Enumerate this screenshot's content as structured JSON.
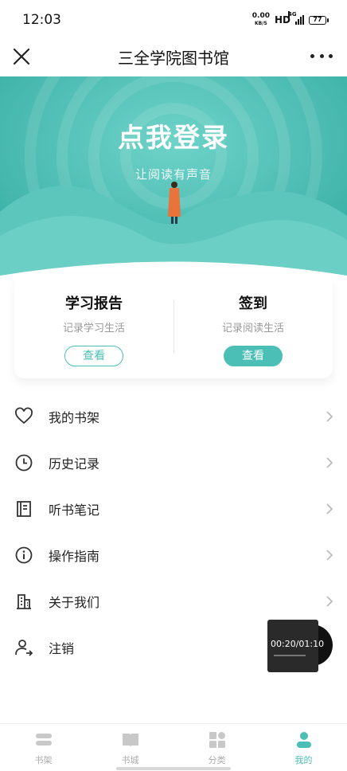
{
  "status_bar": {
    "time": "12:03",
    "net_speed_value": "0.00",
    "net_speed_unit": "KB/S",
    "hd": "HD",
    "network": "4G",
    "battery": "77"
  },
  "nav": {
    "title": "三全学院图书馆",
    "close_icon": "close-icon",
    "more_icon": "more-icon"
  },
  "banner": {
    "login_title": "点我登录",
    "subtitle": "让阅读有声音",
    "color": "#4bbfb5"
  },
  "cards": [
    {
      "title": "学习报告",
      "desc": "记录学习生活",
      "button": "查看"
    },
    {
      "title": "签到",
      "desc": "记录阅读生活",
      "button": "查看"
    }
  ],
  "menu": [
    {
      "label": "我的书架",
      "icon": "heart-icon"
    },
    {
      "label": "历史记录",
      "icon": "clock-icon"
    },
    {
      "label": "听书笔记",
      "icon": "notebook-icon"
    },
    {
      "label": "操作指南",
      "icon": "info-icon"
    },
    {
      "label": "关于我们",
      "icon": "building-icon"
    },
    {
      "label": "注销",
      "icon": "user-logout-icon"
    }
  ],
  "player": {
    "time": "00:20/01:10"
  },
  "tabs": [
    {
      "label": "书架",
      "icon": "bookshelf-icon",
      "active": false
    },
    {
      "label": "书城",
      "icon": "book-icon",
      "active": false
    },
    {
      "label": "分类",
      "icon": "category-icon",
      "active": false
    },
    {
      "label": "我的",
      "icon": "user-icon",
      "active": true
    }
  ],
  "colors": {
    "accent": "#4bbfb5",
    "inactive": "#aaaaaa"
  }
}
